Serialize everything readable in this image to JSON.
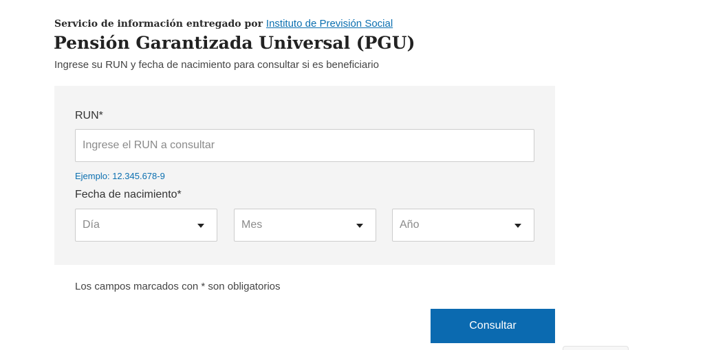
{
  "header": {
    "provider_text": "Servicio de información entregado por",
    "provider_link": "Instituto de Previsión Social",
    "title": "Pensión Garantizada Universal (PGU)",
    "subtitle": "Ingrese su RUN y fecha de nacimiento para consultar si es beneficiario"
  },
  "form": {
    "run_label": "RUN*",
    "run_placeholder": "Ingrese el RUN a consultar",
    "run_value": "",
    "run_hint": "Ejemplo: 12.345.678-9",
    "birth_label": "Fecha de nacimiento*",
    "day_placeholder": "Día",
    "month_placeholder": "Mes",
    "year_placeholder": "Año",
    "dropdown_icon": "caret-down-icon"
  },
  "required_note": "Los campos marcados con * son obligatorios",
  "submit_label": "Consultar",
  "colors": {
    "accent": "#0b6ab0",
    "link": "#0b6fb0",
    "panel_bg": "#f4f4f4"
  }
}
